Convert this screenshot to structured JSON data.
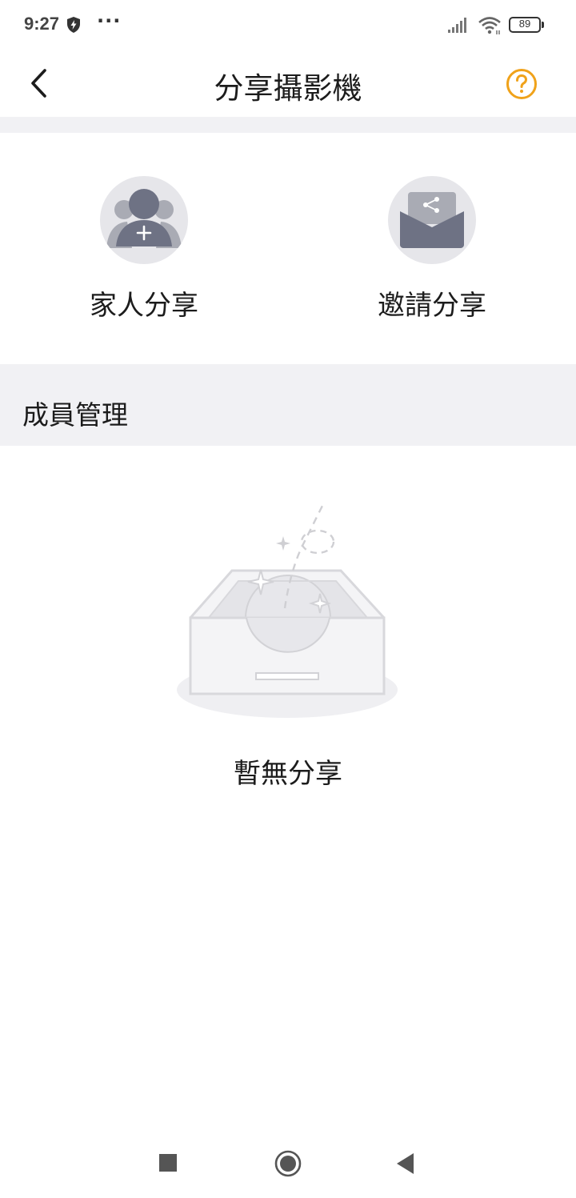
{
  "status_bar": {
    "time": "9:27",
    "more": "···",
    "battery_level": "89",
    "icons": [
      "shield-bolt-icon",
      "signal-icon",
      "wifi-icon",
      "battery-icon"
    ]
  },
  "header": {
    "title": "分享攝影機",
    "back_icon": "chevron-left-icon",
    "help_icon": "question-circle-icon",
    "accent_color": "#f0a21a"
  },
  "share_options": [
    {
      "label": "家人分享",
      "icon": "add-family-member-icon"
    },
    {
      "label": "邀請分享",
      "icon": "share-envelope-icon"
    }
  ],
  "members": {
    "section_title": "成員管理",
    "empty_text": "暫無分享",
    "empty_icon": "empty-box-icon"
  },
  "system_nav": {
    "icons": [
      "recent-apps-square-icon",
      "home-circle-icon",
      "back-triangle-icon"
    ]
  }
}
